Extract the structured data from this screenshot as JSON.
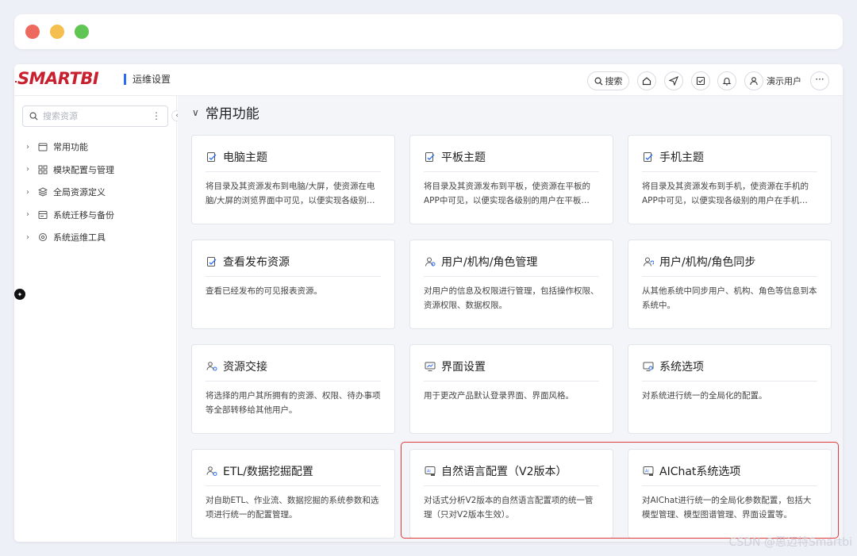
{
  "header": {
    "logo": "SMARTBI",
    "section": "运维设置",
    "search_label": "搜索",
    "user_name": "演示用户"
  },
  "sidebar": {
    "search_placeholder": "搜索资源",
    "items": [
      {
        "label": "常用功能",
        "icon": "calendar-icon"
      },
      {
        "label": "模块配置与管理",
        "icon": "grid-icon"
      },
      {
        "label": "全局资源定义",
        "icon": "layers-icon"
      },
      {
        "label": "系统迁移与备份",
        "icon": "migrate-icon"
      },
      {
        "label": "系统运维工具",
        "icon": "tools-icon"
      }
    ]
  },
  "main": {
    "title": "常用功能",
    "cards": [
      {
        "title": "电脑主题",
        "desc": "将目录及其资源发布到电脑/大屏，使资源在电脑/大屏的浏览界面中可见，以便实现各级别…",
        "icon": "publish-icon"
      },
      {
        "title": "平板主题",
        "desc": "将目录及其资源发布到平板，使资源在平板的APP中可见，以便实现各级别的用户在平板…",
        "icon": "publish-icon"
      },
      {
        "title": "手机主题",
        "desc": "将目录及其资源发布到手机，使资源在手机的APP中可见，以便实现各级别的用户在手机…",
        "icon": "publish-icon"
      },
      {
        "title": "查看发布资源",
        "desc": "查看已经发布的可见报表资源。",
        "icon": "publish-icon"
      },
      {
        "title": "用户/机构/角色管理",
        "desc": "对用户的信息及权限进行管理，包括操作权限、资源权限、数据权限。",
        "icon": "users-icon"
      },
      {
        "title": "用户/机构/角色同步",
        "desc": "从其他系统中同步用户、机构、角色等信息到本系统中。",
        "icon": "user-sync-icon"
      },
      {
        "title": "资源交接",
        "desc": "将选择的用户其所拥有的资源、权限、待办事项等全部转移给其他用户。",
        "icon": "handover-icon"
      },
      {
        "title": "界面设置",
        "desc": "用于更改产品默认登录界面、界面风格。",
        "icon": "monitor-icon"
      },
      {
        "title": "系统选项",
        "desc": "对系统进行统一的全局化的配置。",
        "icon": "settings-icon"
      },
      {
        "title": "ETL/数据挖掘配置",
        "desc": "对自助ETL、作业流、数据挖掘的系统参数和选项进行统一的配置管理。",
        "icon": "etl-icon"
      },
      {
        "title": "自然语言配置（V2版本）",
        "desc": "对话式分析V2版本的自然语言配置项的统一管理（只对V2版本生效）。",
        "icon": "nlp-icon"
      },
      {
        "title": "AIChat系统选项",
        "desc": "对AIChat进行统一的全局化参数配置，包括大模型管理、模型图谱管理、界面设置等。",
        "icon": "aichat-icon"
      }
    ]
  },
  "watermark": "CSDN @思迈特Smartbi",
  "colors": {
    "brand": "#c8202e",
    "accent": "#2a6cf6",
    "highlight": "#e03a3a"
  }
}
